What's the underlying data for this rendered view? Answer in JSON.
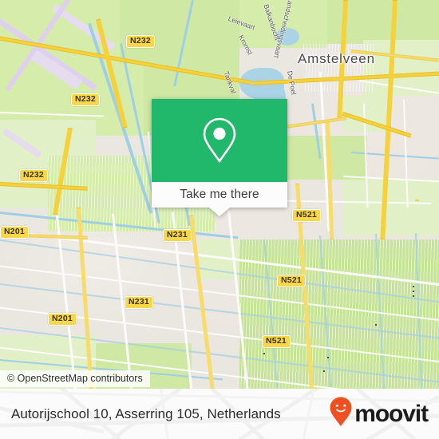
{
  "map": {
    "attribution": "© OpenStreetMap contributors",
    "city_label": "Amstelveen",
    "road_shields": [
      {
        "id": "shield-n232-a",
        "label": "N232"
      },
      {
        "id": "shield-n232-b",
        "label": "N232"
      },
      {
        "id": "shield-n232-c",
        "label": "N232"
      },
      {
        "id": "shield-n201-a",
        "label": "N201"
      },
      {
        "id": "shield-n201-b",
        "label": "N201"
      },
      {
        "id": "shield-n231-a",
        "label": "N231"
      },
      {
        "id": "shield-n231-b",
        "label": "N231"
      },
      {
        "id": "shield-n521-a",
        "label": "N521"
      },
      {
        "id": "shield-n521-b",
        "label": "N521"
      },
      {
        "id": "shield-n521-c",
        "label": "N521"
      }
    ],
    "water_labels": [
      {
        "id": "label-leievaart",
        "text": "Leievaart"
      },
      {
        "id": "label-kromsl",
        "text": "Kromsl"
      },
      {
        "id": "label-tankval",
        "text": "Tankval"
      },
      {
        "id": "label-balkanbocht",
        "text": "Balkanbocht"
      },
      {
        "id": "label-landscheidingsvaart",
        "text": "Landscheidingsvaart"
      },
      {
        "id": "label-depoel",
        "text": "De Poel"
      }
    ],
    "colors": {
      "highway": "#f5d13c",
      "shield_fill": "#f8d84a",
      "water": "#aad3e6",
      "park": "#d5ecab",
      "urban": "#eae6e0",
      "airport": "#e6dcf0"
    }
  },
  "popup": {
    "action_label": "Take me there",
    "icon": "map-pin-icon",
    "accent_color": "#21b86b"
  },
  "footer": {
    "title": "Autorijschool 10, Asserring 105, Netherlands",
    "brand_name": "moovit",
    "brand_color": "#ef5022",
    "brand_icon": "moovit-pin-icon"
  }
}
